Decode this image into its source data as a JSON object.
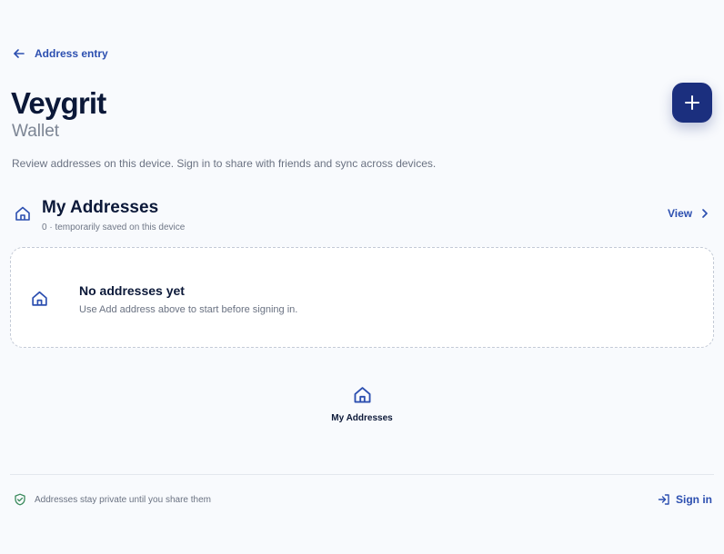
{
  "header": {
    "back_label": "Address entry",
    "title": "Veygrit",
    "subtitle": "Wallet",
    "description": "Review addresses on this device. Sign in to share with friends and sync across devices."
  },
  "fab": {
    "icon": "plus-icon"
  },
  "section": {
    "title": "My Addresses",
    "subtitle": "0 · temporarily saved on this device",
    "view_label": "View"
  },
  "empty_state": {
    "title": "No addresses yet",
    "text": "Use Add address above to start before signing in."
  },
  "bottom_nav": {
    "items": [
      {
        "label": "My Addresses",
        "icon": "home-icon"
      }
    ]
  },
  "footer": {
    "note": "Addresses stay private until you share them",
    "sign_in_label": "Sign in"
  },
  "colors": {
    "accent": "#2c4fb0",
    "fab": "#1b2f7e",
    "text_dark": "#0b1838",
    "muted": "#6a7282",
    "success": "#3a8a5c"
  }
}
